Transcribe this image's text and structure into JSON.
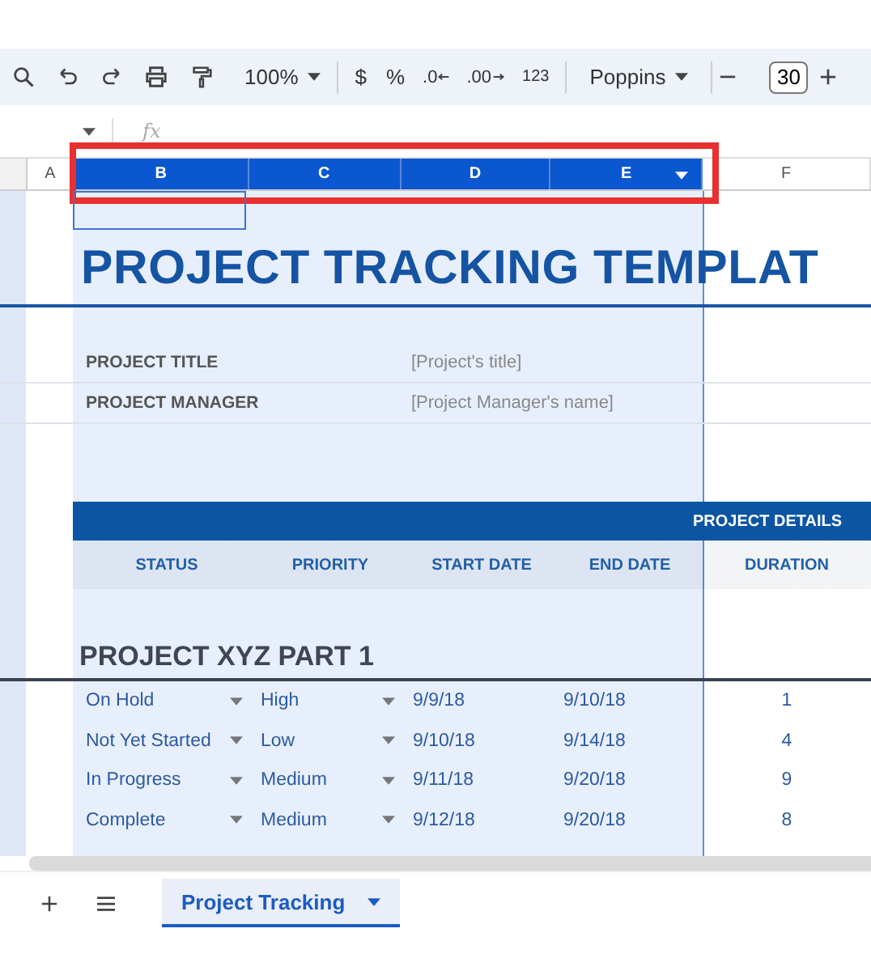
{
  "toolbar": {
    "zoom": "100%",
    "currency": "$",
    "percent": "%",
    "decrease_decimals": ".0",
    "increase_decimals": ".00",
    "number_format": "123",
    "font": "Poppins",
    "font_size": "30"
  },
  "formula_bar": {
    "fx_label": "fx"
  },
  "columns": [
    {
      "label": "A",
      "selected": false
    },
    {
      "label": "B",
      "selected": true
    },
    {
      "label": "C",
      "selected": true
    },
    {
      "label": "D",
      "selected": true
    },
    {
      "label": "E",
      "selected": true
    },
    {
      "label": "F",
      "selected": false
    }
  ],
  "sheet": {
    "title": "PROJECT TRACKING TEMPLAT",
    "fields": [
      {
        "label": "PROJECT TITLE",
        "hint": "[Project's title]"
      },
      {
        "label": "PROJECT MANAGER",
        "hint": "[Project Manager's name]"
      }
    ],
    "details_banner": "PROJECT DETAILS",
    "headers": [
      "STATUS",
      "PRIORITY",
      "START DATE",
      "END DATE",
      "DURATION"
    ],
    "section_title": "PROJECT XYZ PART 1",
    "rows": [
      {
        "status": "On Hold",
        "priority": "High",
        "start": "9/9/18",
        "end": "9/10/18",
        "duration": "1"
      },
      {
        "status": "Not Yet Started",
        "priority": "Low",
        "start": "9/10/18",
        "end": "9/14/18",
        "duration": "4"
      },
      {
        "status": "In Progress",
        "priority": "Medium",
        "start": "9/11/18",
        "end": "9/20/18",
        "duration": "9"
      },
      {
        "status": "Complete",
        "priority": "Medium",
        "start": "9/12/18",
        "end": "9/20/18",
        "duration": "8"
      }
    ]
  },
  "sheet_tabs": [
    {
      "label": "Project Tracking",
      "selected": true
    }
  ]
}
